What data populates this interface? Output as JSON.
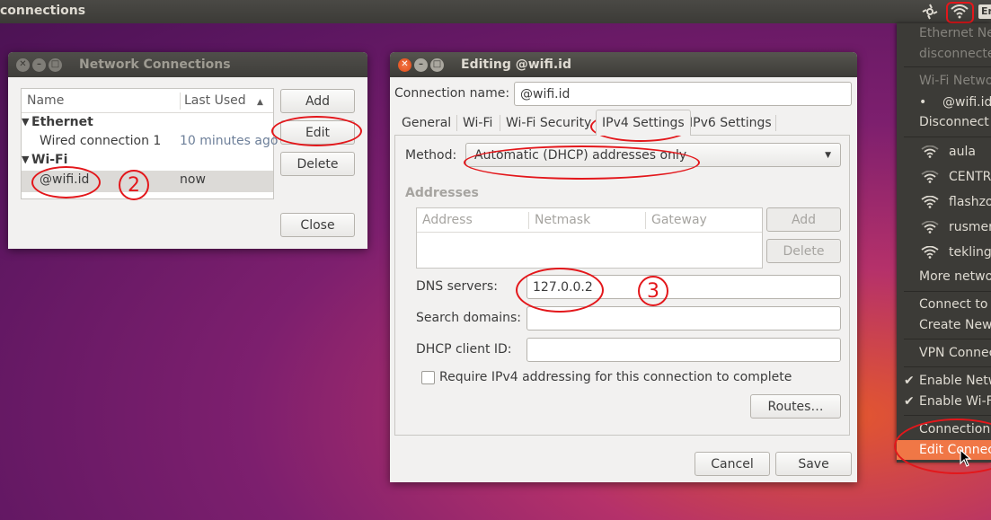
{
  "panel": {
    "title": "connections",
    "keyboard": "En"
  },
  "netwin": {
    "title": "Network Connections",
    "col_name": "Name",
    "col_last_used": "Last Used",
    "group_ethernet": "Ethernet",
    "wired_name": "Wired connection 1",
    "wired_time": "10 minutes ago",
    "group_wifi": "Wi-Fi",
    "wifi_name": "@wifi.id",
    "wifi_time": "now",
    "add": "Add",
    "edit": "Edit",
    "delete": "Delete",
    "close": "Close"
  },
  "editwin": {
    "title": "Editing @wifi.id",
    "conn_name_label": "Connection name:",
    "conn_name_value": "@wifi.id",
    "tabs": [
      "General",
      "Wi-Fi",
      "Wi-Fi Security",
      "IPv4 Settings",
      "IPv6 Settings"
    ],
    "method_label": "Method:",
    "method_value": "Automatic (DHCP) addresses only",
    "addresses_label": "Addresses",
    "col_address": "Address",
    "col_netmask": "Netmask",
    "col_gateway": "Gateway",
    "add": "Add",
    "delete": "Delete",
    "dns_label": "DNS servers:",
    "dns_value": "127.0.0.2",
    "search_label": "Search domains:",
    "dhcp_label": "DHCP client ID:",
    "require_label": "Require IPv4 addressing for this connection to complete",
    "routes": "Routes…",
    "cancel": "Cancel",
    "save": "Save"
  },
  "annotations": {
    "two": "2",
    "three": "3"
  },
  "menu": {
    "ethernet_header": "Ethernet Ne",
    "ethernet_status": "disconnecte",
    "wifi_header": "Wi-Fi Netwo",
    "current_net": "@wifi.id",
    "disconnect": "Disconnect",
    "networks": [
      "aula",
      "CENTRA",
      "flashzo",
      "rusmer",
      "tekling"
    ],
    "more": "More netwo",
    "connect_hidden": "Connect to H",
    "create_new": "Create New",
    "vpn": "VPN Connec",
    "enable_net": "Enable Netw",
    "enable_wifi": "Enable Wi-Fi",
    "conn_info": "Connection",
    "edit_conn": "Edit Connec"
  },
  "colors": {
    "annotation": "#e3171b",
    "highlight": "#f07746",
    "panel": "#3c3b37"
  }
}
